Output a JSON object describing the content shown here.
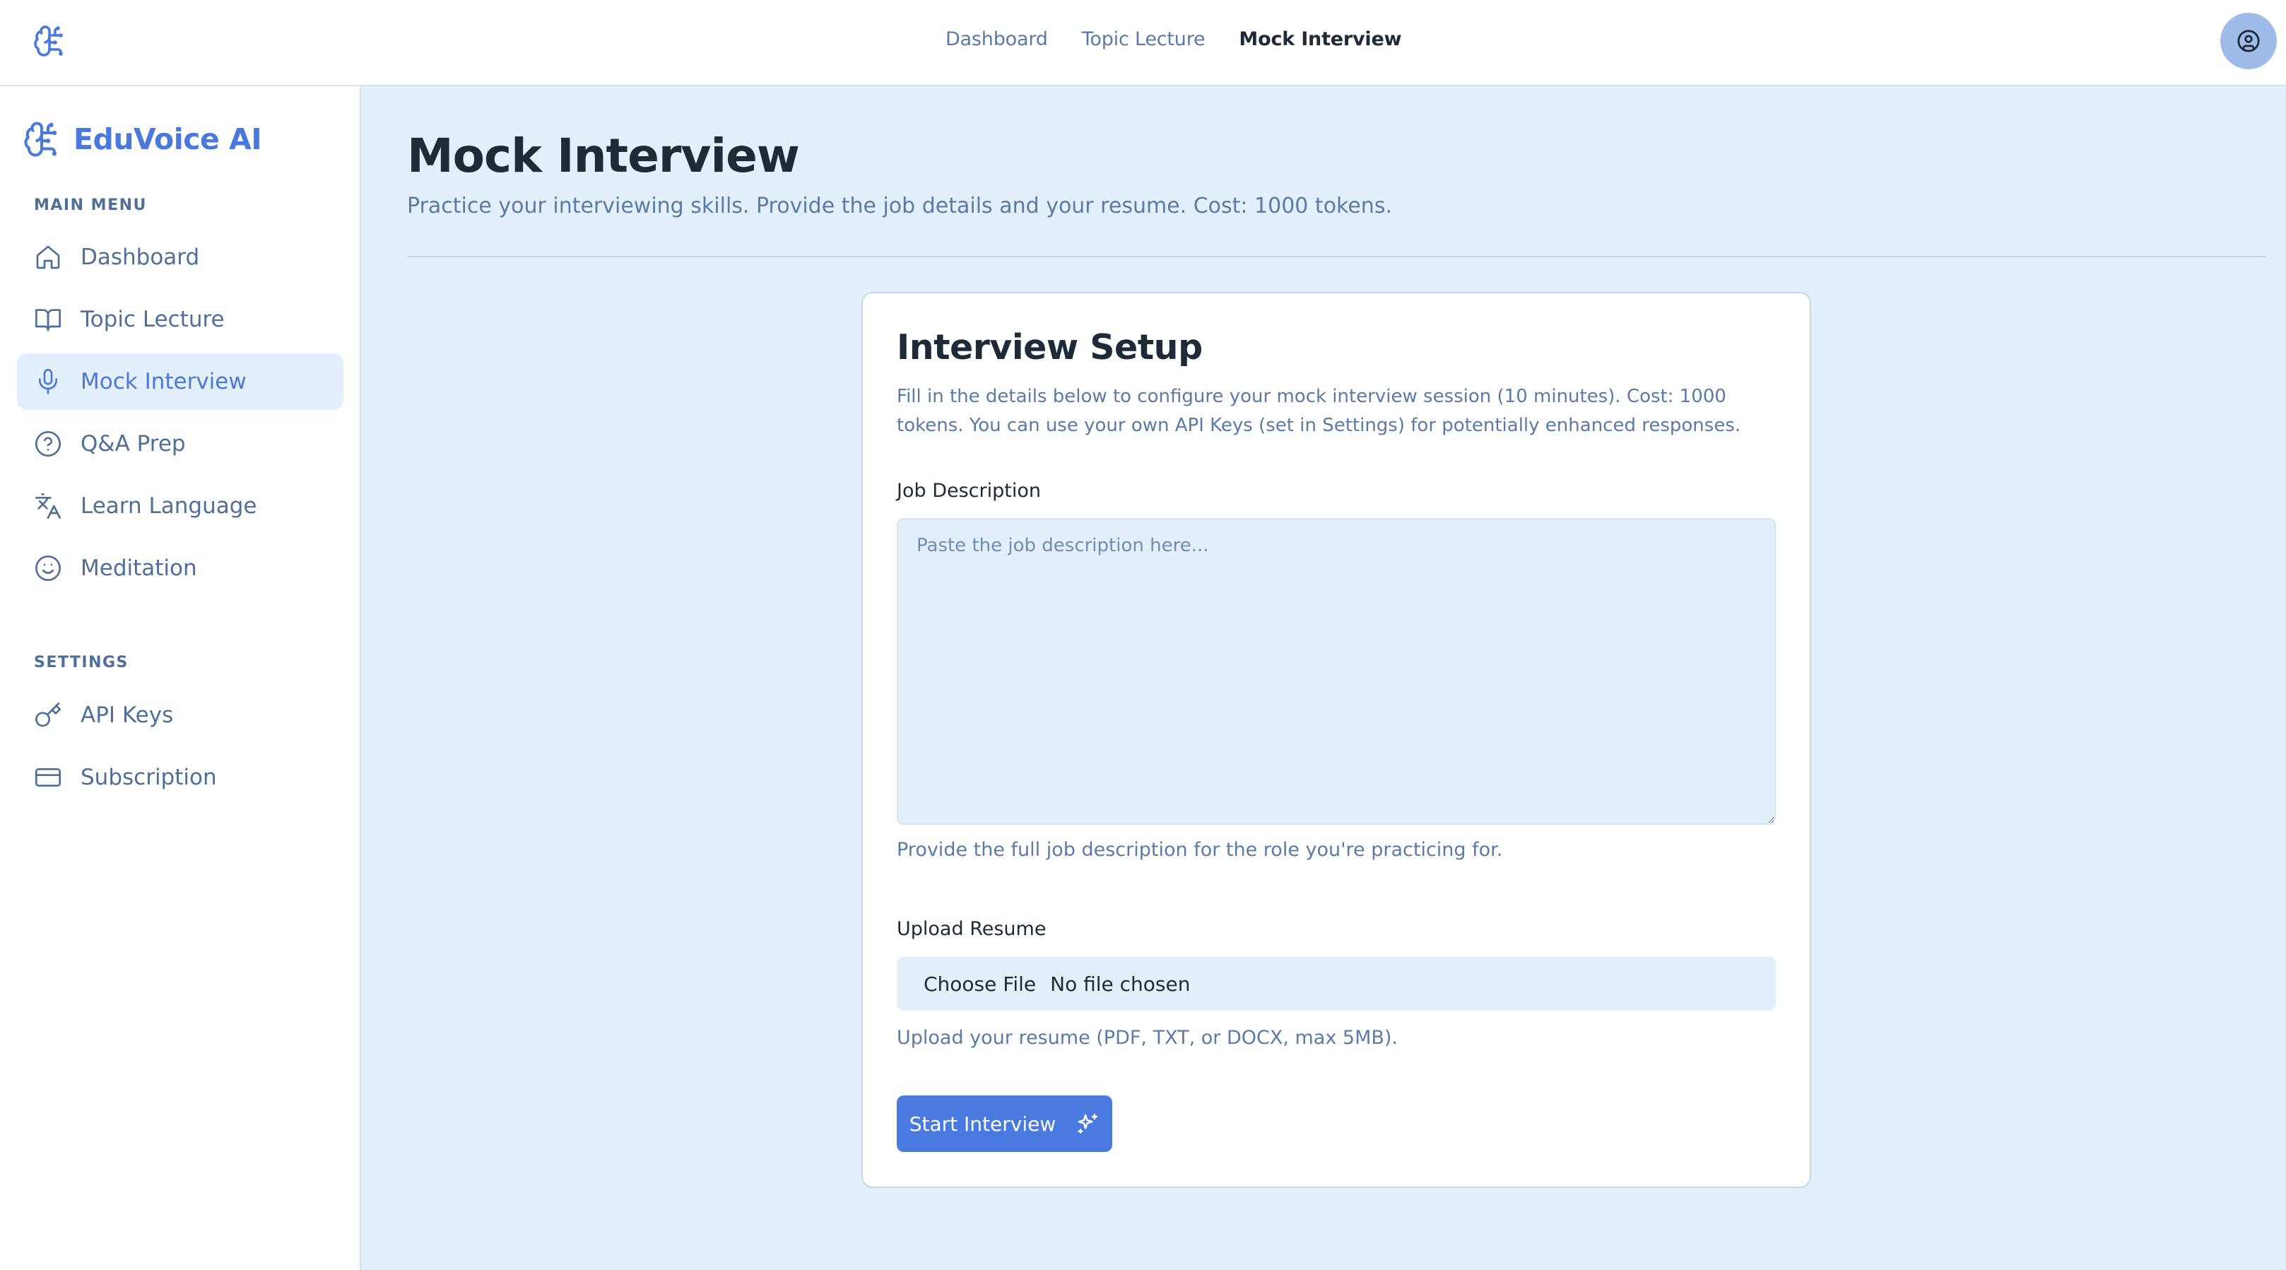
{
  "app": {
    "brand_name": "EduVoice AI",
    "accent_color": "#4a79db"
  },
  "topnav": {
    "items": [
      {
        "label": "Dashboard",
        "active": false
      },
      {
        "label": "Topic Lecture",
        "active": false
      },
      {
        "label": "Mock Interview",
        "active": true
      }
    ],
    "avatar_icon": "user-circle-icon"
  },
  "sidebar": {
    "main_menu_title": "MAIN MENU",
    "main_items": [
      {
        "label": "Dashboard",
        "icon": "home-icon",
        "active": false
      },
      {
        "label": "Topic Lecture",
        "icon": "book-open-icon",
        "active": false
      },
      {
        "label": "Mock Interview",
        "icon": "microphone-icon",
        "active": true
      },
      {
        "label": "Q&A Prep",
        "icon": "question-circle-icon",
        "active": false
      },
      {
        "label": "Learn Language",
        "icon": "translate-icon",
        "active": false
      },
      {
        "label": "Meditation",
        "icon": "smile-icon",
        "active": false
      }
    ],
    "settings_title": "SETTINGS",
    "settings_items": [
      {
        "label": "API Keys",
        "icon": "key-icon",
        "active": false
      },
      {
        "label": "Subscription",
        "icon": "credit-card-icon",
        "active": false
      }
    ]
  },
  "main": {
    "title": "Mock Interview",
    "subtitle": "Practice your interviewing skills. Provide the job details and your resume. Cost: 1000 tokens."
  },
  "setup": {
    "title": "Interview Setup",
    "description": "Fill in the details below to configure your mock interview session (10 minutes). Cost: 1000 tokens. You can use your own API Keys (set in Settings) for potentially enhanced responses.",
    "job_label": "Job Description",
    "job_placeholder": "Paste the job description here...",
    "job_value": "",
    "job_hint": "Provide the full job description for the role you're practicing for.",
    "resume_label": "Upload Resume",
    "choose_file_label": "Choose File",
    "no_file_text": "No file chosen",
    "resume_hint": "Upload your resume (PDF, TXT, or DOCX, max 5MB).",
    "start_label": "Start Interview",
    "start_icon": "sparkles-icon"
  }
}
